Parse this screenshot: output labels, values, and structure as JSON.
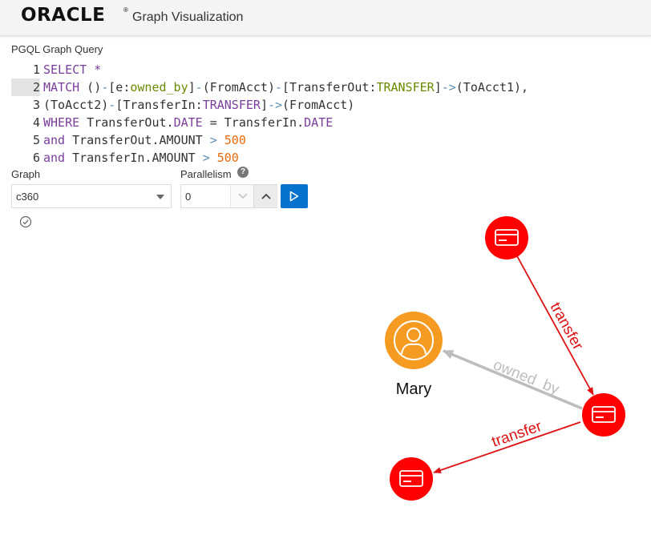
{
  "header": {
    "brand": "ORACLE",
    "brand_mark": "®",
    "title": "Graph Visualization"
  },
  "query": {
    "label": "PGQL Graph Query",
    "active_line": 2,
    "lines": [
      {
        "num": "1",
        "tokens": [
          {
            "t": "SELECT *",
            "c": "kw"
          }
        ]
      },
      {
        "num": "2",
        "tokens": [
          {
            "t": "MATCH",
            "c": "kw"
          },
          {
            "t": " ()",
            "c": "plain"
          },
          {
            "t": "-",
            "c": "op"
          },
          {
            "t": "[e:",
            "c": "plain"
          },
          {
            "t": "owned_by",
            "c": "label"
          },
          {
            "t": "]",
            "c": "plain"
          },
          {
            "t": "-",
            "c": "op"
          },
          {
            "t": "(FromAcct)",
            "c": "plain"
          },
          {
            "t": "-",
            "c": "op"
          },
          {
            "t": "[TransferOut:",
            "c": "plain"
          },
          {
            "t": "TRANSFER",
            "c": "label"
          },
          {
            "t": "]",
            "c": "plain"
          },
          {
            "t": "->",
            "c": "op"
          },
          {
            "t": "(ToAcct1),",
            "c": "plain"
          }
        ]
      },
      {
        "num": "3",
        "tokens": [
          {
            "t": "(ToAcct2)",
            "c": "plain"
          },
          {
            "t": "-",
            "c": "op"
          },
          {
            "t": "[TransferIn:",
            "c": "plain"
          },
          {
            "t": "TRANSFER",
            "c": "kw"
          },
          {
            "t": "]",
            "c": "plain"
          },
          {
            "t": "->",
            "c": "op"
          },
          {
            "t": "(FromAcct)",
            "c": "plain"
          }
        ]
      },
      {
        "num": "4",
        "tokens": [
          {
            "t": "WHERE",
            "c": "kw"
          },
          {
            "t": " TransferOut.",
            "c": "plain"
          },
          {
            "t": "DATE",
            "c": "kw"
          },
          {
            "t": " = TransferIn.",
            "c": "plain"
          },
          {
            "t": "DATE",
            "c": "kw"
          }
        ]
      },
      {
        "num": "5",
        "tokens": [
          {
            "t": "and",
            "c": "kw"
          },
          {
            "t": " TransferOut.AMOUNT ",
            "c": "plain"
          },
          {
            "t": ">",
            "c": "op"
          },
          {
            "t": " ",
            "c": "plain"
          },
          {
            "t": "500",
            "c": "num"
          }
        ]
      },
      {
        "num": "6",
        "tokens": [
          {
            "t": "and",
            "c": "kw"
          },
          {
            "t": " TransferIn.AMOUNT ",
            "c": "plain"
          },
          {
            "t": ">",
            "c": "op"
          },
          {
            "t": " ",
            "c": "plain"
          },
          {
            "t": "500",
            "c": "num"
          }
        ]
      }
    ]
  },
  "controls": {
    "graph_label": "Graph",
    "graph_value": "c360",
    "parallelism_label": "Parallelism",
    "parallelism_value": "0",
    "help_glyph": "?"
  },
  "graph_view": {
    "colors": {
      "account": "#ff0000",
      "person": "#f59b22",
      "transfer_edge": "#dd1111",
      "owned_by_edge": "#bdbdbd"
    },
    "nodes": [
      {
        "id": "acct-top",
        "type": "account",
        "icon": "credit-card-icon"
      },
      {
        "id": "person-mary",
        "type": "person",
        "icon": "user-icon",
        "label": "Mary"
      },
      {
        "id": "acct-right",
        "type": "account",
        "icon": "credit-card-icon"
      },
      {
        "id": "acct-bottom",
        "type": "account",
        "icon": "credit-card-icon"
      }
    ],
    "edges": [
      {
        "from": "acct-top",
        "to": "acct-right",
        "label": "transfer"
      },
      {
        "from": "acct-right",
        "to": "person-mary",
        "label": "owned_by"
      },
      {
        "from": "acct-right",
        "to": "acct-bottom",
        "label": "transfer"
      }
    ]
  }
}
